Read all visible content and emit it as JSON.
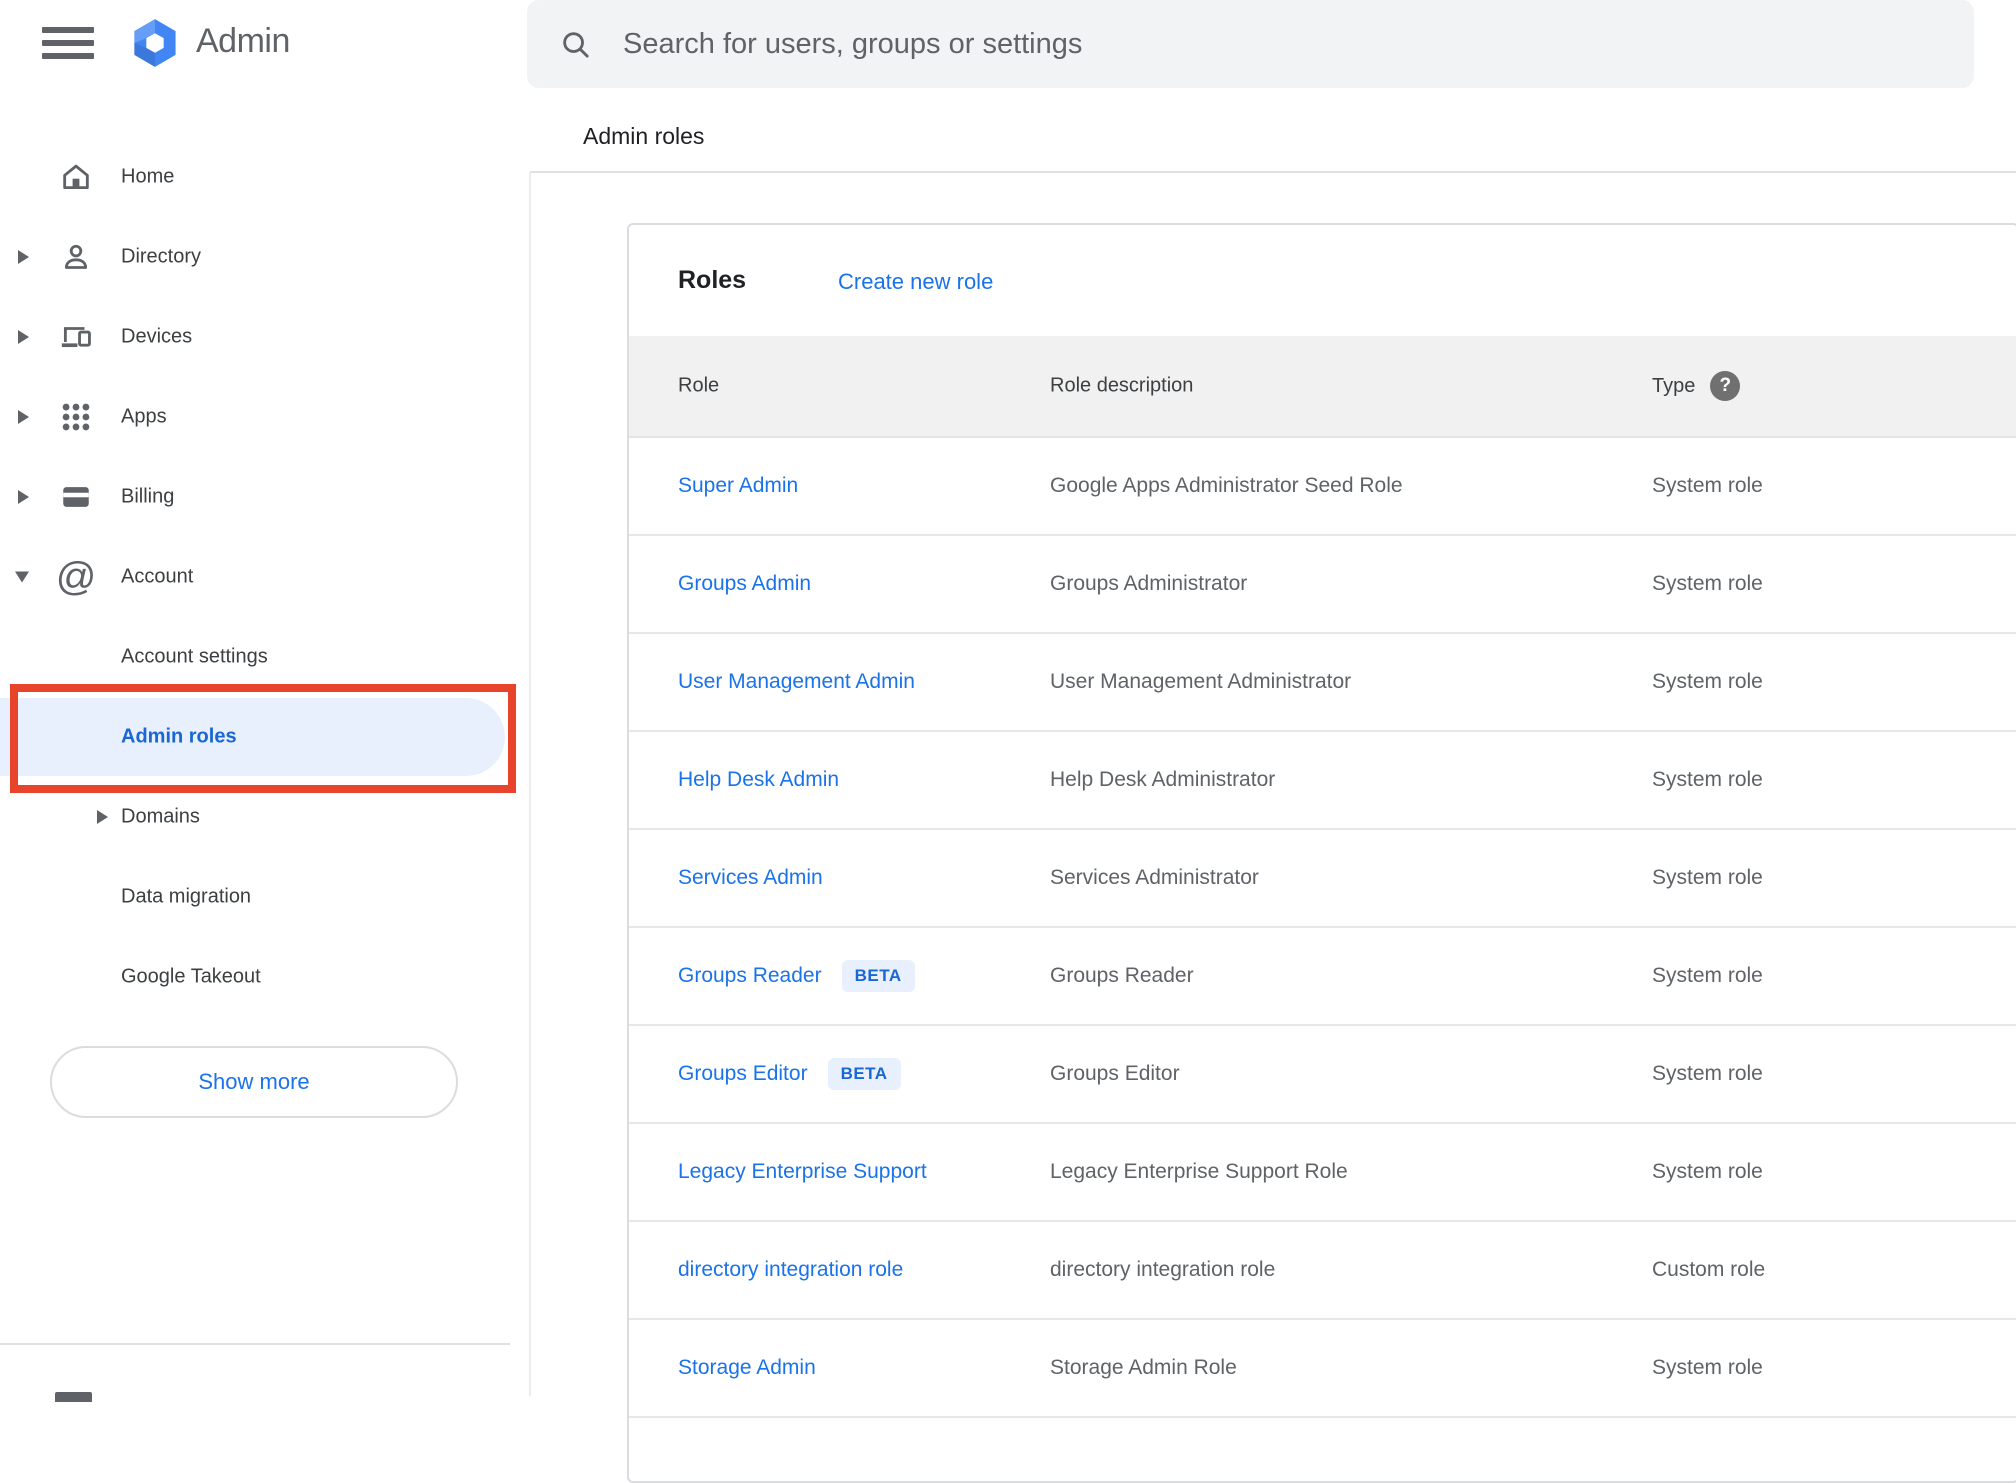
{
  "header": {
    "product_name": "Admin",
    "search_placeholder": "Search for users, groups or settings",
    "breadcrumb": "Admin roles"
  },
  "sidebar": {
    "items": [
      {
        "label": "Home",
        "icon": "home-icon",
        "arrow": "none",
        "level": "main"
      },
      {
        "label": "Directory",
        "icon": "person-icon",
        "arrow": "right",
        "level": "main"
      },
      {
        "label": "Devices",
        "icon": "devices-icon",
        "arrow": "right",
        "level": "main"
      },
      {
        "label": "Apps",
        "icon": "apps-grid-icon",
        "arrow": "right",
        "level": "main"
      },
      {
        "label": "Billing",
        "icon": "credit-card-icon",
        "arrow": "right",
        "level": "main"
      },
      {
        "label": "Account",
        "icon": "at-sign-icon",
        "arrow": "down",
        "level": "main",
        "expanded": true
      },
      {
        "label": "Account settings",
        "arrow": "none",
        "level": "child"
      },
      {
        "label": "Admin roles",
        "arrow": "none",
        "level": "child",
        "selected": true,
        "annotated": true
      },
      {
        "label": "Domains",
        "arrow": "right-inner",
        "level": "child"
      },
      {
        "label": "Data migration",
        "arrow": "none",
        "level": "child"
      },
      {
        "label": "Google Takeout",
        "arrow": "none",
        "level": "child"
      }
    ],
    "show_more_label": "Show more"
  },
  "main": {
    "title": "Roles",
    "create_link": "Create new role",
    "table": {
      "columns": [
        "Role",
        "Role description",
        "Type"
      ],
      "beta_badge_label": "BETA",
      "rows": [
        {
          "role": "Super Admin",
          "beta": false,
          "description": "Google Apps Administrator Seed Role",
          "type": "System role"
        },
        {
          "role": "Groups Admin",
          "beta": false,
          "description": "Groups Administrator",
          "type": "System role"
        },
        {
          "role": "User Management Admin",
          "beta": false,
          "description": "User Management Administrator",
          "type": "System role"
        },
        {
          "role": "Help Desk Admin",
          "beta": false,
          "description": "Help Desk Administrator",
          "type": "System role"
        },
        {
          "role": "Services Admin",
          "beta": false,
          "description": "Services Administrator",
          "type": "System role"
        },
        {
          "role": "Groups Reader",
          "beta": true,
          "description": "Groups Reader",
          "type": "System role"
        },
        {
          "role": "Groups Editor",
          "beta": true,
          "description": "Groups Editor",
          "type": "System role"
        },
        {
          "role": "Legacy Enterprise Support",
          "beta": false,
          "description": "Legacy Enterprise Support Role",
          "type": "System role"
        },
        {
          "role": "directory integration role",
          "beta": false,
          "description": "directory integration role",
          "type": "Custom role"
        },
        {
          "role": "Storage Admin",
          "beta": false,
          "description": "Storage Admin Role",
          "type": "System role"
        }
      ]
    }
  },
  "colors": {
    "link_blue": "#1A73E8",
    "selected_blue": "#1967D2",
    "selected_bg": "#E8F0FE",
    "annotation_red": "#E8432B",
    "header_gray_bg": "#F1F1F1",
    "icon_gray": "#5F6368"
  }
}
